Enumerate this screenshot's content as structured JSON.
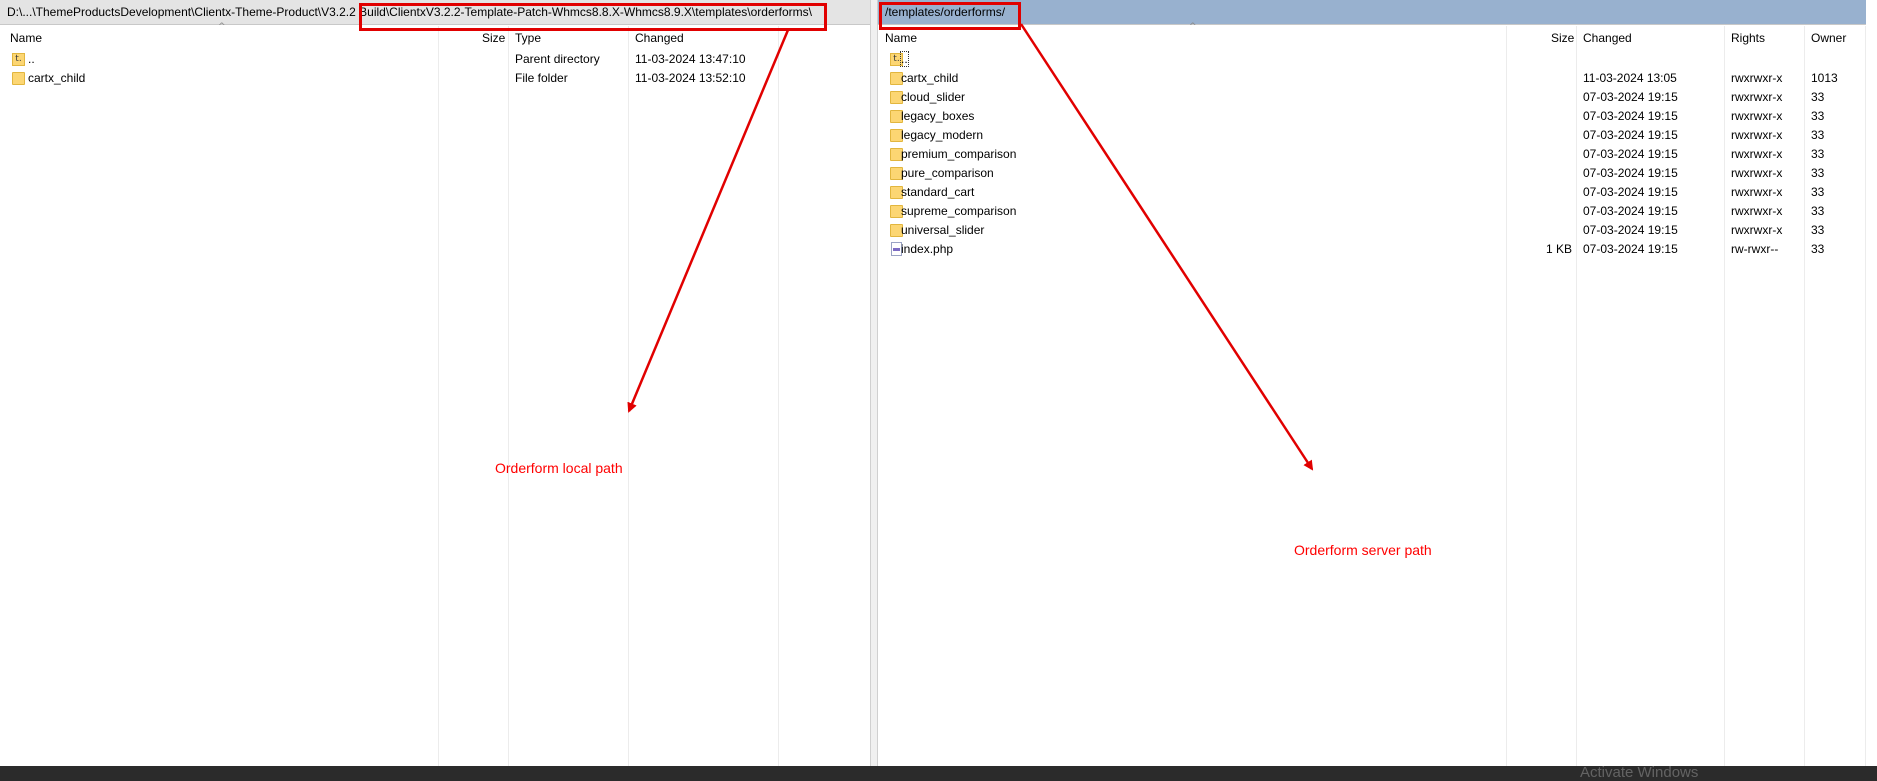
{
  "local": {
    "path": "D:\\...\\ThemeProductsDevelopment\\Clientx-Theme-Product\\V3.2.2 Build\\ClientxV3.2.2-Template-Patch-Whmcs8.8.X-Whmcs8.9.X\\templates\\orderforms\\",
    "columns": {
      "name": "Name",
      "size": "Size",
      "type": "Type",
      "changed": "Changed"
    },
    "rows": [
      {
        "icon": "parent-directory-icon",
        "name": "..",
        "size": "",
        "type": "Parent directory",
        "changed": "11-03-2024 13:47:10"
      },
      {
        "icon": "folder-icon",
        "name": "cartx_child",
        "size": "",
        "type": "File folder",
        "changed": "11-03-2024 13:52:10"
      }
    ]
  },
  "remote": {
    "path": "/templates/orderforms/",
    "columns": {
      "name": "Name",
      "size": "Size",
      "changed": "Changed",
      "rights": "Rights",
      "owner": "Owner"
    },
    "rows": [
      {
        "icon": "parent-directory-icon",
        "name": "..",
        "size": "",
        "changed": "",
        "rights": "",
        "owner": ""
      },
      {
        "icon": "folder-icon",
        "name": "cartx_child",
        "size": "",
        "changed": "11-03-2024 13:05",
        "rights": "rwxrwxr-x",
        "owner": "1013"
      },
      {
        "icon": "folder-icon",
        "name": "cloud_slider",
        "size": "",
        "changed": "07-03-2024 19:15",
        "rights": "rwxrwxr-x",
        "owner": "33"
      },
      {
        "icon": "folder-icon",
        "name": "legacy_boxes",
        "size": "",
        "changed": "07-03-2024 19:15",
        "rights": "rwxrwxr-x",
        "owner": "33"
      },
      {
        "icon": "folder-icon",
        "name": "legacy_modern",
        "size": "",
        "changed": "07-03-2024 19:15",
        "rights": "rwxrwxr-x",
        "owner": "33"
      },
      {
        "icon": "folder-icon",
        "name": "premium_comparison",
        "size": "",
        "changed": "07-03-2024 19:15",
        "rights": "rwxrwxr-x",
        "owner": "33"
      },
      {
        "icon": "folder-icon",
        "name": "pure_comparison",
        "size": "",
        "changed": "07-03-2024 19:15",
        "rights": "rwxrwxr-x",
        "owner": "33"
      },
      {
        "icon": "folder-icon",
        "name": "standard_cart",
        "size": "",
        "changed": "07-03-2024 19:15",
        "rights": "rwxrwxr-x",
        "owner": "33"
      },
      {
        "icon": "folder-icon",
        "name": "supreme_comparison",
        "size": "",
        "changed": "07-03-2024 19:15",
        "rights": "rwxrwxr-x",
        "owner": "33"
      },
      {
        "icon": "folder-icon",
        "name": "universal_slider",
        "size": "",
        "changed": "07-03-2024 19:15",
        "rights": "rwxrwxr-x",
        "owner": "33"
      },
      {
        "icon": "php-file-icon",
        "name": "index.php",
        "size": "1 KB",
        "changed": "07-03-2024 19:15",
        "rights": "rw-rwxr--",
        "owner": "33"
      }
    ]
  },
  "annotations": {
    "local_label": "Orderform local path",
    "server_label": "Orderform server path",
    "color": "#ff0000"
  },
  "watermark": "Activate Windows"
}
